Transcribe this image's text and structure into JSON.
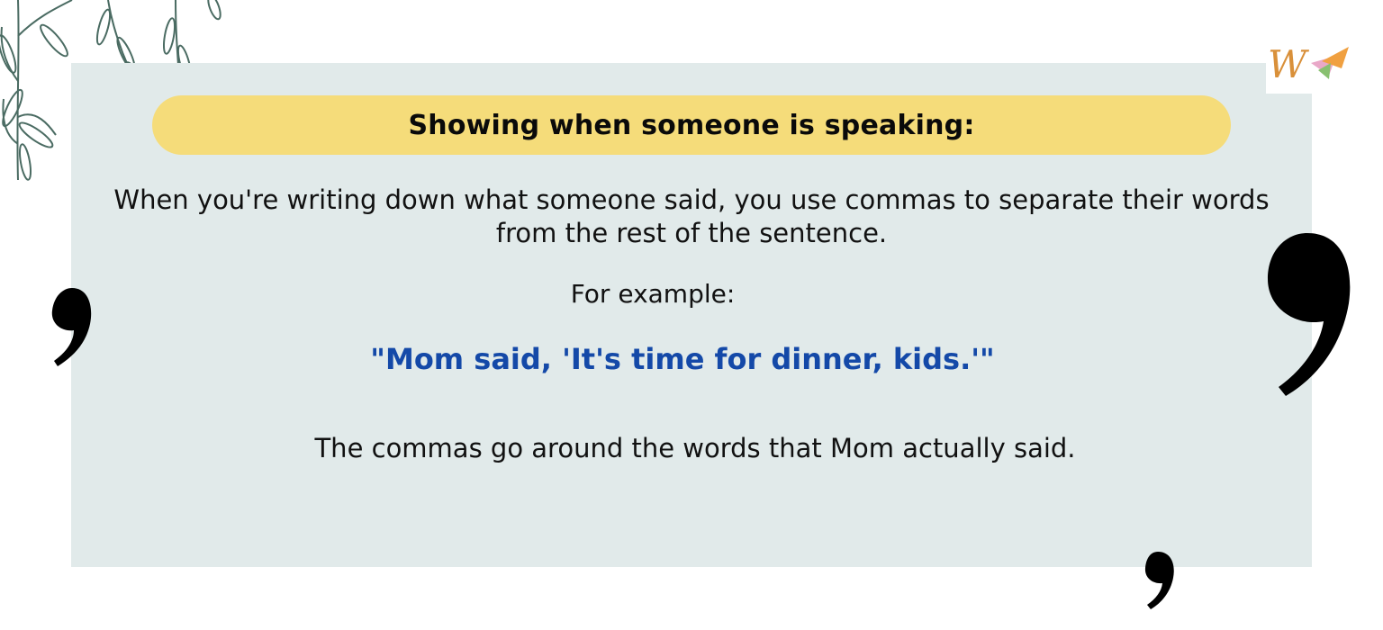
{
  "heading": "Showing when someone is speaking:",
  "intro_text": "When you're writing down what someone said, you use commas to separate their words from the rest of the sentence.",
  "example_label": "For example:",
  "example_quote": "\"Mom said, 'It's time for dinner, kids.'\"",
  "explanation": "The commas go around the words that Mom actually said.",
  "logo_text": "W",
  "colors": {
    "panel": "#e1eaea",
    "banner": "#f5dc7a",
    "quote": "#1449a8",
    "leaf": "#4a6b62",
    "comma": "#000000"
  },
  "icons": [
    "leaf-branch-icon",
    "comma-icon",
    "brand-logo-icon"
  ]
}
